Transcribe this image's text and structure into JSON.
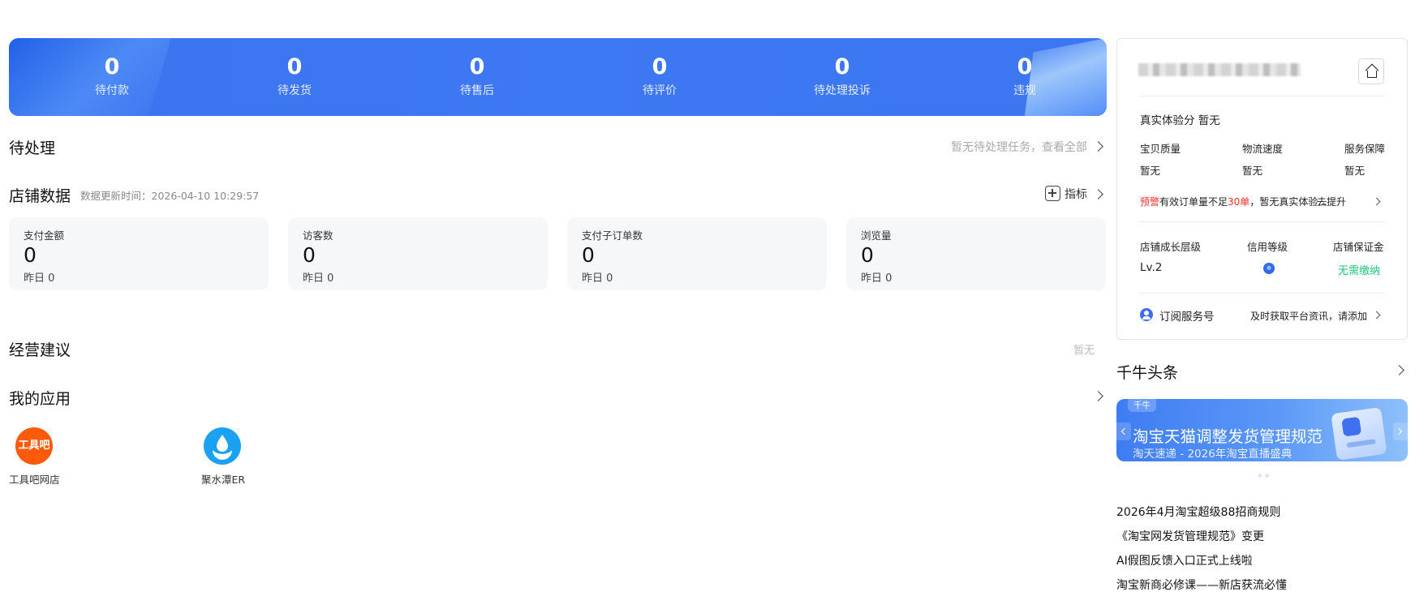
{
  "order_stats": [
    {
      "value": "0",
      "label": "待付款"
    },
    {
      "value": "0",
      "label": "待发货"
    },
    {
      "value": "0",
      "label": "待售后"
    },
    {
      "value": "0",
      "label": "待评价"
    },
    {
      "value": "0",
      "label": "待处理投诉"
    },
    {
      "value": "0",
      "label": "违规"
    }
  ],
  "pending": {
    "title": "待处理",
    "link": "暂无待处理任务，查看全部"
  },
  "store_data": {
    "title": "店铺数据",
    "update_time": "数据更新时间：2026-04-10 10:29:57",
    "metrics_label": "指标",
    "cards": [
      {
        "title": "支付金额",
        "value": "0",
        "yesterday": "昨日 0"
      },
      {
        "title": "访客数",
        "value": "0",
        "yesterday": "昨日 0"
      },
      {
        "title": "支付子订单数",
        "value": "0",
        "yesterday": "昨日 0"
      },
      {
        "title": "浏览量",
        "value": "0",
        "yesterday": "昨日 0"
      }
    ]
  },
  "advice": {
    "title": "经营建议",
    "empty": "暂无"
  },
  "my_apps": {
    "title": "我的应用",
    "apps": [
      {
        "name": "工具吧网店",
        "icon_text": "工具吧",
        "icon": "toolbar-app-icon",
        "color": "#ff5a0a"
      },
      {
        "name": "聚水潭ER",
        "icon": "jushuitan-app-icon",
        "color": "#1aa1f2"
      }
    ]
  },
  "shop_card": {
    "experience_label": "真实体验分",
    "experience_value": "暂无",
    "scores": [
      {
        "label": "宝贝质量",
        "value": "暂无"
      },
      {
        "label": "物流速度",
        "value": "暂无"
      },
      {
        "label": "服务保障",
        "value": "暂无"
      }
    ],
    "warning_prefix": "预警",
    "warning_mid": "有效订单量不足",
    "warning_num": "30单",
    "warning_rest": "，暂无真实体验...",
    "improve_link": "去提升",
    "growth": {
      "label": "店铺成长层级",
      "value": "Lv.2"
    },
    "credit": {
      "label": "信用等级"
    },
    "deposit": {
      "label": "店铺保证金",
      "value": "无需缴纳"
    },
    "subscribe_label": "订阅服务号",
    "subscribe_desc": "及时获取平台资讯，请添加"
  },
  "news": {
    "title": "千牛头条",
    "banner_tag": "千牛",
    "banner_title": "淘宝天猫调整发货管理规范",
    "banner_subtitle": "淘天速递 - 2026年淘宝直播盛典",
    "items": [
      "2026年4月淘宝超级88招商规则",
      "《淘宝网发货管理规范》变更",
      "AI假图反馈入口正式上线啦",
      "淘宝新商必修课——新店获流必懂"
    ]
  },
  "colors": {
    "accent": "#3c76f1",
    "warning": "#ff2d2d",
    "success": "#21c27a"
  }
}
